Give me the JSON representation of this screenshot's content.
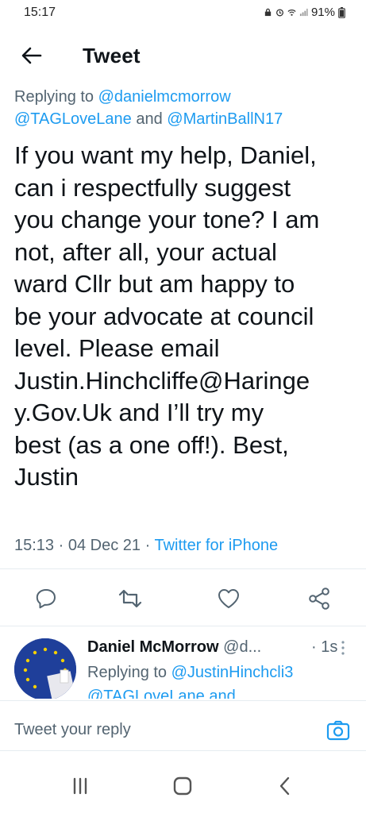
{
  "status": {
    "time": "15:17",
    "battery": "91%"
  },
  "header": {
    "title": "Tweet"
  },
  "tweet": {
    "replying_label": "Replying to",
    "mention_1": "@danielmcmorrow",
    "mention_2": "@TAGLoveLane",
    "and_word": "and",
    "mention_3": "@MartinBallN17",
    "lines": [
      "If you want my help, Daniel,",
      "can i respectfully suggest",
      "you change your tone? I am",
      "not, after all, your actual",
      "ward Cllr but am happy to",
      "be your advocate at council",
      "level. Please email",
      "Justin.Hinchcliffe@Haringe",
      "y.Gov.Uk and I’ll try my",
      "best (as a one off!). Best,",
      "Justin"
    ],
    "time": "15:13",
    "date": "04 Dec 21",
    "source": "Twitter for iPhone",
    "sep": "·"
  },
  "reply": {
    "name": "Daniel McMorrow",
    "handle": "@d...",
    "sep": "·",
    "time": "1s",
    "replying_label": "Replying to",
    "mention": "@JustinHinchcli3",
    "more": "@TAGLoveLane and"
  },
  "compose": {
    "placeholder": "Tweet your reply"
  },
  "colors": {
    "accent": "#1d9bf0",
    "muted": "#536471",
    "text": "#0f1419"
  }
}
